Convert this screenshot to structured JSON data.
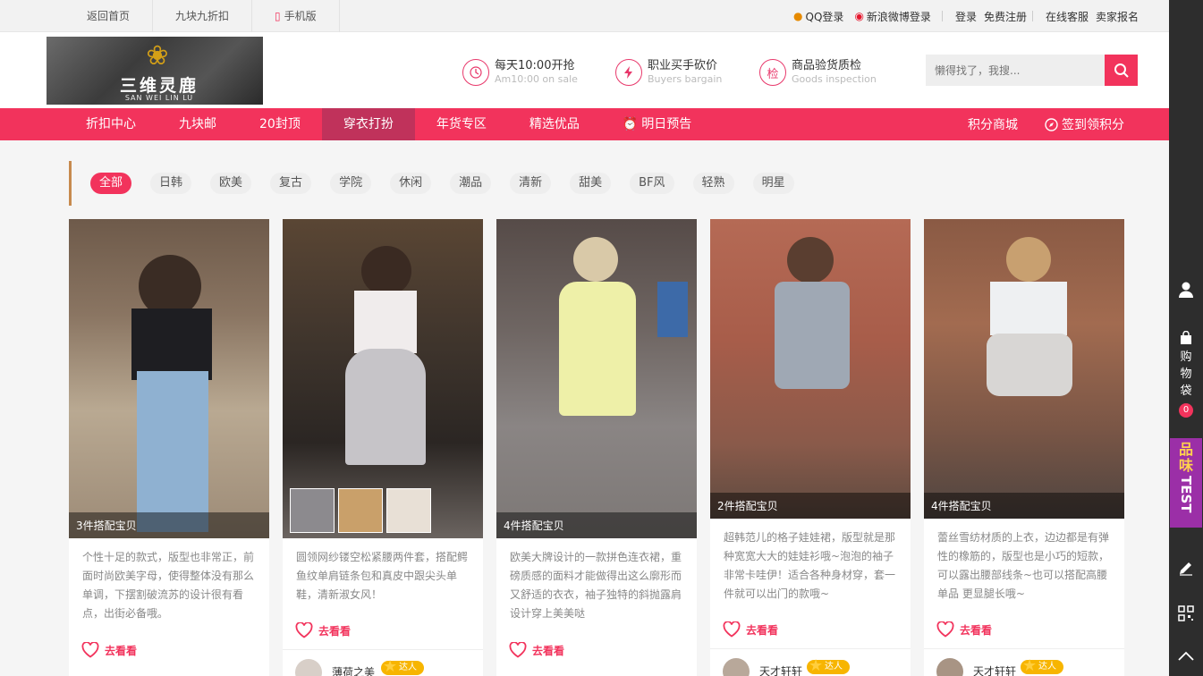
{
  "topbar": {
    "links": [
      "返回首页",
      "九块九折扣",
      "手机版"
    ],
    "qq_login": "QQ登录",
    "weibo_login": "新浪微博登录",
    "login": "登录",
    "register": "免费注册",
    "service": "在线客服",
    "seller": "卖家报名"
  },
  "logo": {
    "cn": "三维灵鹿",
    "en": "SAN WEI LIN LU"
  },
  "features": [
    {
      "icon": "clock-icon",
      "title": "每天10:00开抢",
      "sub": "Am10:00 on sale"
    },
    {
      "icon": "lightning-icon",
      "title": "职业买手砍价",
      "sub": "Buyers bargain"
    },
    {
      "icon": "check-badge-icon",
      "glyph": "检",
      "title": "商品验货质检",
      "sub": "Goods inspection"
    }
  ],
  "search": {
    "placeholder": "懒得找了，我搜..."
  },
  "nav": {
    "items": [
      "折扣中心",
      "九块邮",
      "20封顶",
      "穿衣打扮",
      "年货专区",
      "精选优品",
      "明日预告"
    ],
    "active": "穿衣打扮",
    "points_mall": "积分商城",
    "signin": "签到领积分"
  },
  "filters": {
    "items": [
      "全部",
      "日韩",
      "欧美",
      "复古",
      "学院",
      "休闲",
      "潮品",
      "清新",
      "甜美",
      "BF风",
      "轻熟",
      "明星"
    ],
    "active": "全部"
  },
  "cards": [
    {
      "caption": "3件搭配宝贝",
      "desc": "个性十足的款式，版型也非常正，前面时尚欧美字母，使得整体没有那么单调，下摆割破流苏的设计很有看点，出街必备哦。",
      "look": "去看看",
      "author": "",
      "badge": ""
    },
    {
      "caption": "",
      "desc": "圆领网纱镂空松紧腰两件套，搭配鳄鱼纹单肩链条包和真皮中跟尖头单鞋，清新淑女风！",
      "look": "去看看",
      "author": "薄荷之美",
      "badge": "达人"
    },
    {
      "caption": "4件搭配宝贝",
      "desc": "欧美大牌设计的一款拼色连衣裙，重磅质感的面料才能做得出这么廓形而又舒适的衣衣，袖子独特的斜抛露肩设计穿上美美哒",
      "look": "去看看",
      "author": "",
      "badge": ""
    },
    {
      "caption": "2件搭配宝贝",
      "desc": "超韩范儿的格子娃娃裙，版型就是那种宽宽大大的娃娃衫哦~泡泡的袖子非常卡哇伊！适合各种身材穿，套一件就可以出门的款哦~",
      "look": "去看看",
      "author": "天才轩轩",
      "badge": "达人"
    },
    {
      "caption": "4件搭配宝贝",
      "desc": "蕾丝雪纺材质的上衣，边边都是有弹性的橡筋的，版型也是小巧的短款，可以露出腰部线条~也可以搭配高腰单品 更显腿长哦~",
      "look": "去看看",
      "author": "天才轩轩",
      "badge": "达人"
    }
  ],
  "sidebar": {
    "cart_label": "购物袋",
    "cart_count": "0",
    "promo_top": "品味",
    "promo_bottom": "TEST"
  },
  "colors": {
    "accent": "#f2335c",
    "nav_active": "#c0325b",
    "sidebar": "#2d2d2d",
    "promo": "#9b2fa7"
  }
}
